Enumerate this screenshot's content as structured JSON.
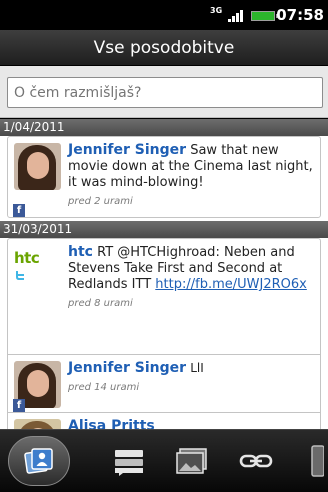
{
  "status_bar": {
    "network": "3G",
    "time": "07:58"
  },
  "header": {
    "title": "Vse posodobitve"
  },
  "search": {
    "placeholder": "O čem razmišljaš?"
  },
  "feed": {
    "groups": [
      {
        "date": "1/04/2011",
        "items": [
          {
            "author": "Jennifer Singer",
            "text": "Saw that new movie down at the Cinema last night, it was mind-blowing!",
            "time": "pred 2 urami",
            "source": "facebook"
          }
        ]
      },
      {
        "date": "31/03/2011",
        "items": [
          {
            "author": "htc",
            "text_pre": "RT ",
            "mention": "@HTCHighroad",
            "text_mid": ": Neben and Stevens Take First and Second at Redlands ITT ",
            "link": "http://fb.me/UWJ2RO6x",
            "time": "pred 8 urami",
            "source": "twitter",
            "logo": "htc"
          },
          {
            "author": "Jennifer Singer",
            "text": "LlI",
            "time": "pred 14 urami",
            "source": "facebook"
          },
          {
            "author": "Alisa Pritts",
            "text": "",
            "time": "",
            "source": "facebook"
          }
        ]
      }
    ]
  },
  "tabs": [
    {
      "name": "updates-tab",
      "icon": "people-icon",
      "active": true
    },
    {
      "name": "messages-tab",
      "icon": "messages-icon",
      "active": false
    },
    {
      "name": "photos-tab",
      "icon": "photos-icon",
      "active": false
    },
    {
      "name": "links-tab",
      "icon": "link-icon",
      "active": false
    },
    {
      "name": "more-tab",
      "icon": "more-icon",
      "active": false
    }
  ],
  "colors": {
    "accent": "#1f5fb4",
    "facebook": "#3b5998",
    "htc_green": "#6aa400",
    "twitter": "#3fb6e6"
  }
}
